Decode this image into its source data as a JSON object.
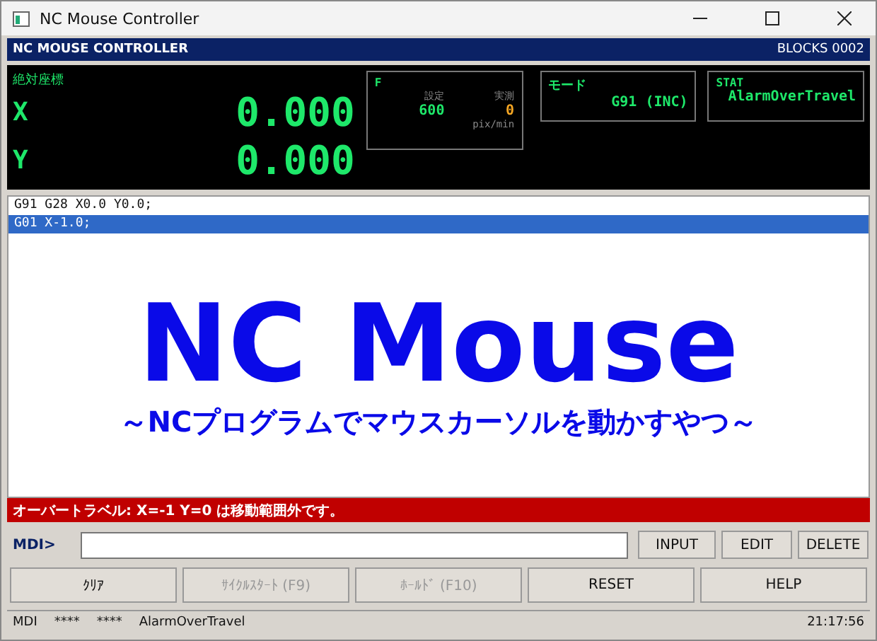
{
  "window": {
    "title": "NC Mouse Controller"
  },
  "header": {
    "title": "NC MOUSE CONTROLLER",
    "blocks": "BLOCKS 0002"
  },
  "position": {
    "label": "絶対座標",
    "axes": [
      {
        "axis": "X",
        "value": "0.000"
      },
      {
        "axis": "Y",
        "value": "0.000"
      }
    ]
  },
  "feed": {
    "label": "F",
    "set_label": "設定",
    "set_value": "600",
    "actual_label": "実測",
    "actual_value": "0",
    "unit": "pix/min"
  },
  "mode": {
    "label": "モード",
    "value": "G91 (INC)"
  },
  "stat": {
    "label": "STAT",
    "value": "AlarmOverTravel"
  },
  "program": {
    "lines": [
      {
        "text": "G91 G28 X0.0 Y0.0;",
        "selected": false
      },
      {
        "text": "G01 X-1.0;",
        "selected": true
      }
    ],
    "banner_title": "NC Mouse",
    "banner_subtitle": "～NCプログラムでマウスカーソルを動かすやつ～"
  },
  "alarm": "オーバートラベル: X=-1 Y=0 は移動範囲外です。",
  "mdi": {
    "label": "MDI>",
    "buttons": [
      "INPUT",
      "EDIT",
      "DELETE"
    ]
  },
  "actions": [
    {
      "label": "ｸﾘｱ",
      "disabled": false
    },
    {
      "label": "ｻｲｸﾙｽﾀｰﾄ (F9)",
      "disabled": true
    },
    {
      "label": "ﾎｰﾙﾄﾞ (F10)",
      "disabled": true
    },
    {
      "label": "RESET",
      "disabled": false
    },
    {
      "label": "HELP",
      "disabled": false
    }
  ],
  "status_bar": {
    "mode": "MDI",
    "field_2": "****",
    "field_3": "****",
    "state": "AlarmOverTravel",
    "time": "21:17:56"
  }
}
